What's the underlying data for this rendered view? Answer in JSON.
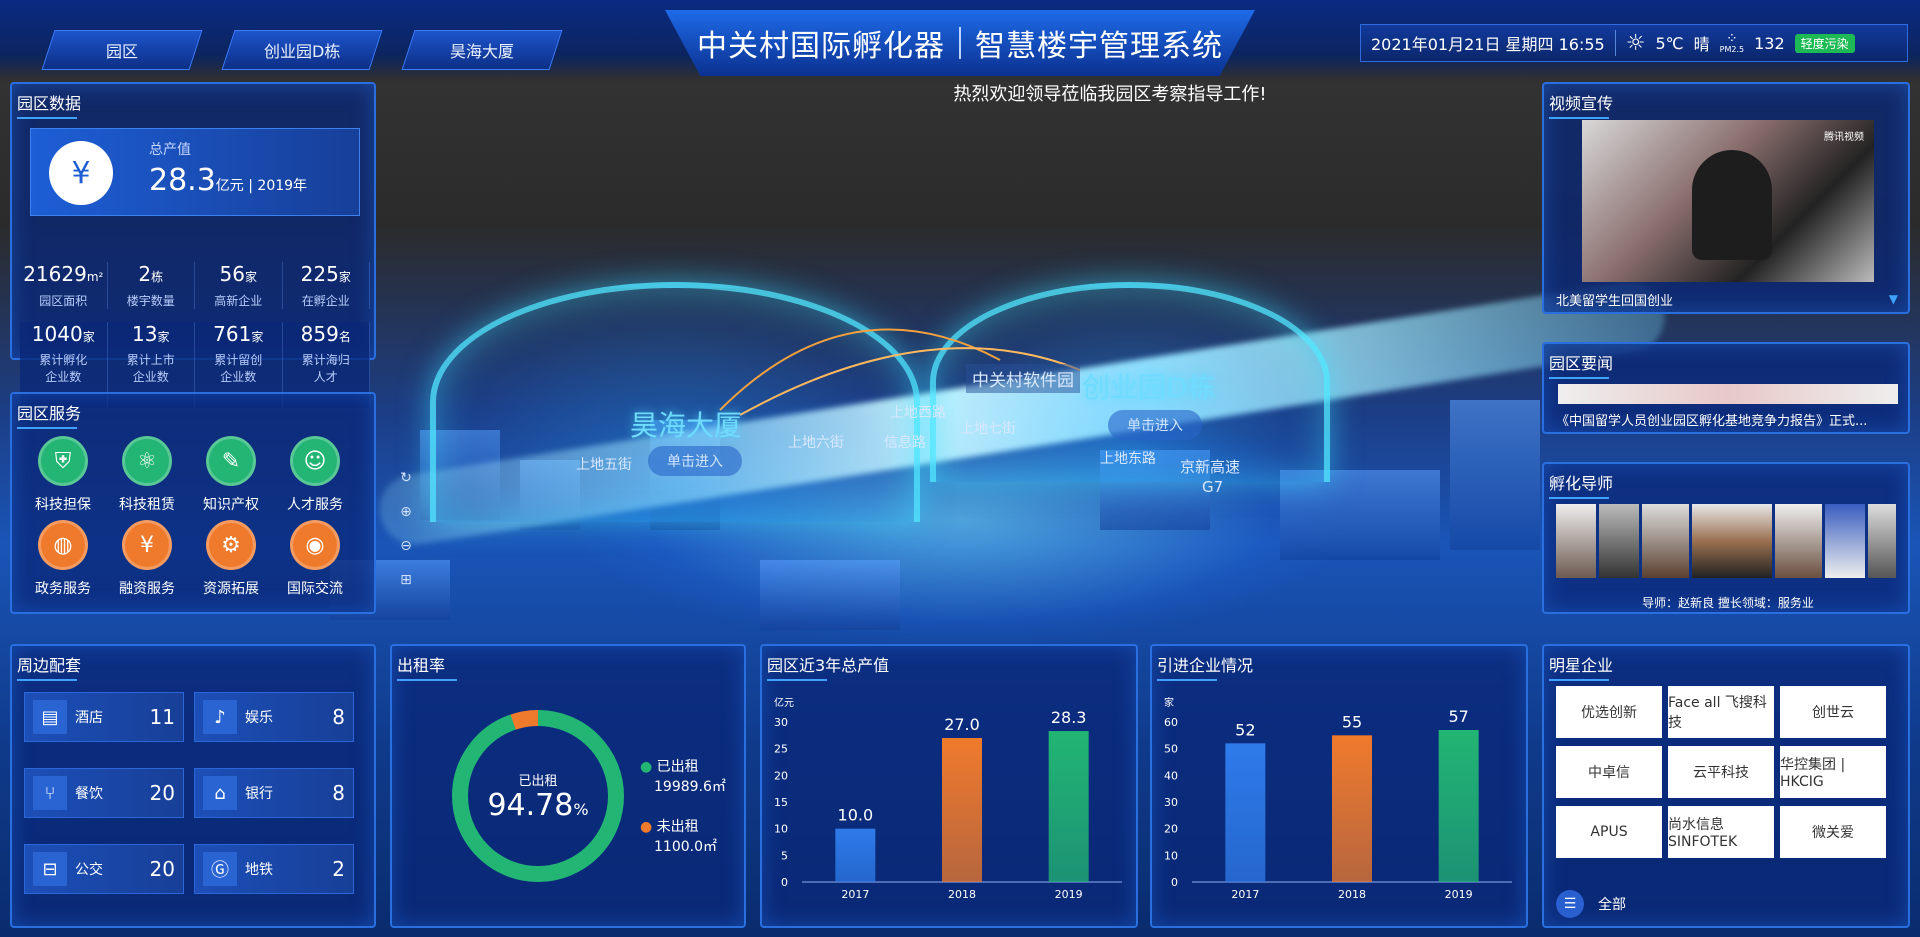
{
  "nav": {
    "tabs": [
      "园区",
      "创业园D栋",
      "昊海大厦"
    ]
  },
  "header": {
    "title_left": "中关村国际孵化器",
    "title_right": "智慧楼宇管理系统",
    "welcome": "热烈欢迎领导莅临我园区考察指导工作!"
  },
  "info": {
    "datetime": "2021年01月21日 星期四 16:55",
    "temp": "5℃",
    "weather": "晴",
    "pm_label": "PM2.5",
    "pm_value": "132",
    "pm_status": "轻度污染"
  },
  "park": {
    "title": "园区数据",
    "gdp_label": "总产值",
    "gdp_value": "28.3",
    "gdp_unit": "亿元 | 2019年",
    "stats": [
      {
        "v": "21629",
        "u": "m²",
        "l": "园区面积"
      },
      {
        "v": "2",
        "u": "栋",
        "l": "楼宇数量"
      },
      {
        "v": "56",
        "u": "家",
        "l": "高新企业"
      },
      {
        "v": "225",
        "u": "家",
        "l": "在孵企业"
      },
      {
        "v": "1040",
        "u": "家",
        "l": "累计孵化企业数"
      },
      {
        "v": "13",
        "u": "家",
        "l": "累计上市企业数"
      },
      {
        "v": "761",
        "u": "家",
        "l": "累计留创企业数"
      },
      {
        "v": "859",
        "u": "名",
        "l": "累计海归人才"
      }
    ]
  },
  "services": {
    "title": "园区服务",
    "items": [
      "科技担保",
      "科技租赁",
      "知识产权",
      "人才服务",
      "政务服务",
      "融资服务",
      "资源拓展",
      "国际交流"
    ]
  },
  "colors": {
    "green": "#22b573",
    "orange": "#f07a2c",
    "blue": "#2e7bea"
  },
  "map": {
    "big1": "昊海大厦",
    "big2": "创业园D栋",
    "park_label": "中关村软件园",
    "enter": "单击进入",
    "roads": [
      "上地五街",
      "上地六街",
      "上地西路",
      "信息路",
      "上地七街",
      "上地东路",
      "京新高速",
      "G7"
    ],
    "controls": [
      "↻",
      "⊕",
      "⊖",
      "⊞"
    ]
  },
  "nearby": {
    "title": "周边配套",
    "items": [
      {
        "l": "酒店",
        "n": "11"
      },
      {
        "l": "娱乐",
        "n": "8"
      },
      {
        "l": "餐饮",
        "n": "20"
      },
      {
        "l": "银行",
        "n": "8"
      },
      {
        "l": "公交",
        "n": "20"
      },
      {
        "l": "地铁",
        "n": "2"
      }
    ]
  },
  "occupancy": {
    "title": "出租率",
    "center_label": "已出租",
    "rate": "94.78",
    "pct": "%",
    "rented_label": "已出租",
    "rented": "19989.6㎡",
    "vacant_label": "未出租",
    "vacant": "1100.0㎡",
    "fraction": 0.9478
  },
  "video": {
    "title": "视频宣传",
    "caption": "北美留学生回国创业",
    "brand": "腾讯视频"
  },
  "news": {
    "title": "园区要闻",
    "headline": "《中国留学人员创业园区孵化基地竞争力报告》正式..."
  },
  "mentors": {
    "title": "孵化导师",
    "caption": "导师：赵新良 擅长领域：服务业"
  },
  "stars": {
    "title": "明星企业",
    "all": "全部",
    "logos": [
      "优选创新",
      "Face all 飞搜科技",
      "创世云",
      "中卓信",
      "云平科技",
      "华控集团 | HKCIG",
      "APUS",
      "尚水信息 SINFOTEK",
      "微关爱"
    ]
  },
  "chart_data": [
    {
      "type": "bar",
      "title": "园区近3年总产值",
      "ylabel": "亿元",
      "categories": [
        "2017",
        "2018",
        "2019"
      ],
      "values": [
        10.0,
        27.0,
        28.3
      ],
      "ylim": [
        0,
        30
      ],
      "yticks": [
        0,
        5,
        10,
        15,
        20,
        25,
        30
      ],
      "colors": [
        "#2e7bea",
        "#f07a2c",
        "#22b573"
      ]
    },
    {
      "type": "bar",
      "title": "引进企业情况",
      "ylabel": "家",
      "categories": [
        "2017",
        "2018",
        "2019"
      ],
      "values": [
        52,
        55,
        57
      ],
      "ylim": [
        0,
        60
      ],
      "yticks": [
        0,
        10,
        20,
        30,
        40,
        50,
        60
      ],
      "colors": [
        "#2e7bea",
        "#f07a2c",
        "#22b573"
      ]
    }
  ]
}
